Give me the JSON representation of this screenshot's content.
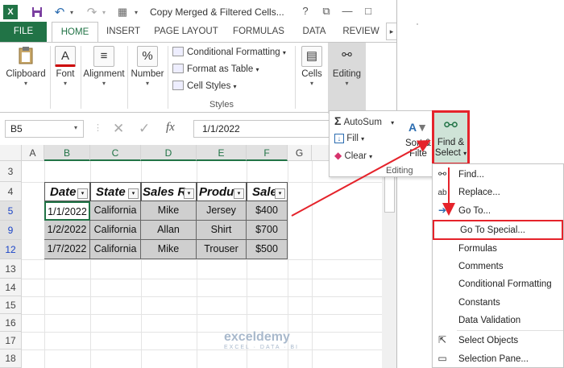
{
  "window": {
    "title": "Copy Merged & Filtered Cells...",
    "help_icon": "?",
    "restore_icon": "⧉",
    "minimize_icon": "—",
    "maximize_icon": "□",
    "app_icon": "X"
  },
  "tabs": [
    "FILE",
    "HOME",
    "INSERT",
    "PAGE LAYOUT",
    "FORMULAS",
    "DATA",
    "REVIEW"
  ],
  "ribbon": {
    "clipboard": "Clipboard",
    "font": "Font",
    "alignment": "Alignment",
    "number": "Number",
    "number_icon": "%",
    "font_icon": "A",
    "conditional_formatting": "Conditional Formatting",
    "format_as_table": "Format as Table",
    "cell_styles": "Cell Styles",
    "styles_group": "Styles",
    "cells": "Cells",
    "editing": "Editing"
  },
  "formula_bar": {
    "name_box": "B5",
    "cancel_icon": "✕",
    "enter_icon": "✓",
    "fx": "fx",
    "value": "1/1/2022"
  },
  "sheet": {
    "columns": [
      "A",
      "B",
      "C",
      "D",
      "E",
      "F",
      "G"
    ],
    "rows": [
      "3",
      "4",
      "5",
      "9",
      "12",
      "13",
      "14",
      "15",
      "16",
      "17",
      "18"
    ],
    "headers": [
      "Date",
      "State",
      "Sales Re",
      "Produ",
      "Sale"
    ],
    "data": [
      [
        "1/1/2022",
        "California",
        "Mike",
        "Jersey",
        "$400"
      ],
      [
        "1/2/2022",
        "California",
        "Allan",
        "Shirt",
        "$700"
      ],
      [
        "1/7/2022",
        "California",
        "Mike",
        "Trouser",
        "$500"
      ]
    ]
  },
  "editing_group": {
    "autosum": "AutoSum",
    "fill": "Fill",
    "clear": "Clear",
    "sort_filter_1": "Sort &",
    "sort_filter_2": "Filte",
    "label": "Editing",
    "find_select_1": "Find &",
    "find_select_2": "Select"
  },
  "menu": {
    "items": [
      "Find...",
      "Replace...",
      "Go To...",
      "Go To Special...",
      "Formulas",
      "Comments",
      "Conditional Formatting",
      "Constants",
      "Data Validation",
      "Select Objects",
      "Selection Pane..."
    ]
  },
  "watermark": {
    "name": "exceldemy",
    "tagline": "EXCEL · DATA · BI"
  },
  "colors": {
    "excel_green": "#217346",
    "highlight_red": "#e5232b",
    "filtered_row_blue": "#1a44c7"
  }
}
